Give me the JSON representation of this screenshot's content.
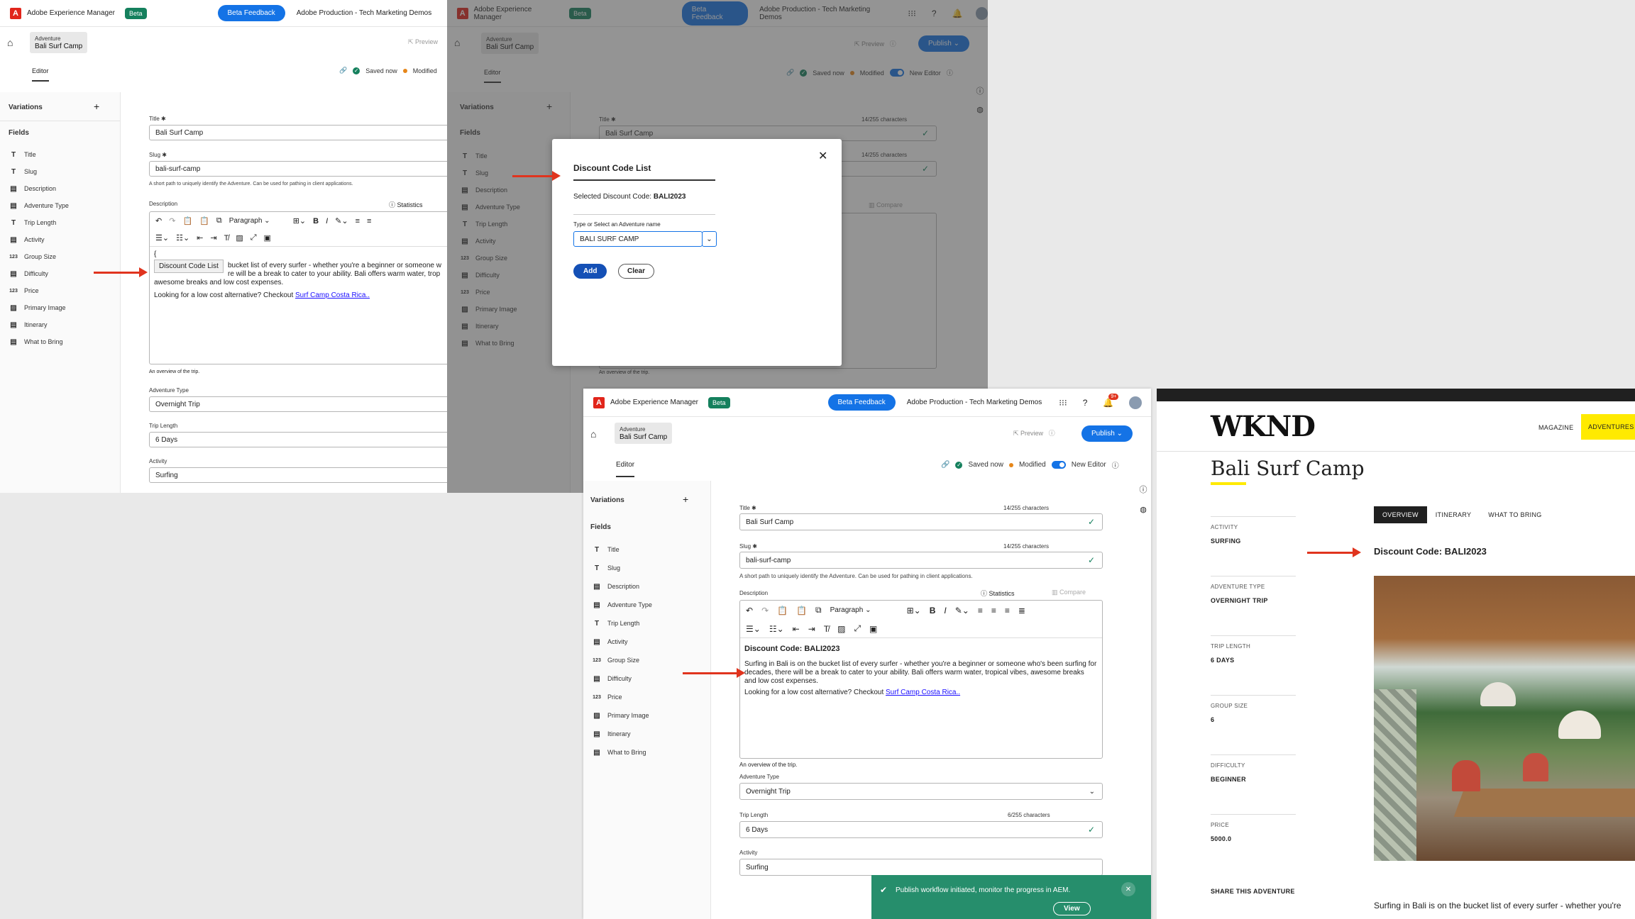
{
  "app": {
    "name": "Adobe Experience Manager",
    "beta": "Beta",
    "feedback": "Beta Feedback",
    "org": "Adobe Production - Tech Marketing Demos",
    "preview": "Preview",
    "publish": "Publish",
    "notification_count": "9+"
  },
  "breadcrumb": {
    "parent": "Adventure",
    "current": "Bali Surf Camp"
  },
  "editor_tab": "Editor",
  "status": {
    "saved": "Saved now",
    "modified": "Modified",
    "new_editor": "New Editor"
  },
  "sidebar": {
    "variations": "Variations",
    "fields_heading": "Fields",
    "fields": [
      {
        "icon": "T",
        "label": "Title"
      },
      {
        "icon": "T",
        "label": "Slug"
      },
      {
        "icon": "▤",
        "label": "Description"
      },
      {
        "icon": "▤",
        "label": "Adventure Type"
      },
      {
        "icon": "T",
        "label": "Trip Length"
      },
      {
        "icon": "▤",
        "label": "Activity"
      },
      {
        "icon": "123",
        "label": "Group Size"
      },
      {
        "icon": "▤",
        "label": "Difficulty"
      },
      {
        "icon": "123",
        "label": "Price"
      },
      {
        "icon": "▨",
        "label": "Primary Image"
      },
      {
        "icon": "▤",
        "label": "Itinerary"
      },
      {
        "icon": "▤",
        "label": "What to Bring"
      }
    ]
  },
  "form": {
    "title_label": "Title",
    "title_value": "Bali Surf Camp",
    "title_count": "14/255 characters",
    "slug_label": "Slug",
    "slug_value": "bali-surf-camp",
    "slug_count": "14/255 characters",
    "slug_help": "A short path to uniquely identify the Adventure. Can be used for pathing in client applications.",
    "description_label": "Description",
    "statistics": "Statistics",
    "compare": "Compare",
    "paragraph": "Paragraph",
    "discount_line": "Discount Code: BALI2023",
    "desc_text": "Surfing in Bali is on the bucket list of every surfer - whether you're a beginner or someone who's been surfing for decades, there will be a break to cater to your ability. Bali offers warm water, tropical vibes, awesome breaks and low cost expenses.",
    "desc_text_short": "bucket list of every surfer - whether you're a beginner or someone w",
    "desc_text_short2": "re will be a break to cater to your ability. Bali offers warm water, trop",
    "desc_text_short3": "awesome breaks and low cost expenses.",
    "looking_for": "Looking for a low cost alternative? Checkout",
    "costa_link": "Surf Camp Costa Rica..",
    "overview_help": "An overview of the trip.",
    "adventure_type_label": "Adventure Type",
    "adventure_type_value": "Overnight Trip",
    "trip_length_label": "Trip Length",
    "trip_length_value": "6 Days",
    "trip_length_count": "6/255 characters",
    "activity_label": "Activity",
    "activity_value": "Surfing",
    "brace": "{",
    "autocomplete": "Discount Code List"
  },
  "dialog": {
    "title": "Discount Code List",
    "selected": "Selected Discount Code:",
    "selected_code": "BALI2023",
    "input_label": "Type or Select an Adventure name",
    "input_value": "BALI SURF CAMP",
    "add": "Add",
    "clear": "Clear"
  },
  "toast": {
    "message": "Publish workflow initiated, monitor the progress in AEM.",
    "view": "View"
  },
  "wknd": {
    "logo": "WKND",
    "nav": [
      "MAGAZINE",
      "ADVENTURES"
    ],
    "title": "Bali Surf Camp",
    "tabs": [
      "OVERVIEW",
      "ITINERARY",
      "WHAT TO BRING"
    ],
    "discount": "Discount Code: BALI2023",
    "facts": [
      {
        "label": "ACTIVITY",
        "value": "SURFING"
      },
      {
        "label": "ADVENTURE TYPE",
        "value": "OVERNIGHT TRIP"
      },
      {
        "label": "TRIP LENGTH",
        "value": "6 DAYS"
      },
      {
        "label": "GROUP SIZE",
        "value": "6"
      },
      {
        "label": "DIFFICULTY",
        "value": "BEGINNER"
      },
      {
        "label": "PRICE",
        "value": "5000.0"
      }
    ],
    "share": "SHARE THIS ADVENTURE",
    "body": "Surfing in Bali is on the bucket list of every surfer - whether you're"
  },
  "colors": {
    "accent": "#1473e6",
    "success": "#15805d",
    "arrow": "#e0341e",
    "wknd_yellow": "#ffea00"
  }
}
